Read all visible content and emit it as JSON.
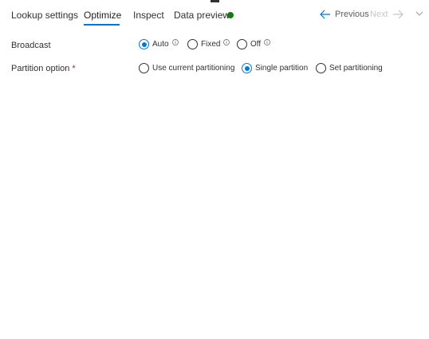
{
  "tabs": [
    {
      "label": "Lookup settings"
    },
    {
      "label": "Optimize"
    },
    {
      "label": "Inspect"
    },
    {
      "label": "Data preview"
    }
  ],
  "active_tab": "Optimize",
  "data_preview_status_color": "#107c10",
  "accent_color": "#0078d4",
  "nav": {
    "previous_label": "Previous",
    "next_label": "Next"
  },
  "broadcast": {
    "label": "Broadcast",
    "options": [
      {
        "label": "Auto",
        "checked": true
      },
      {
        "label": "Fixed",
        "checked": false
      },
      {
        "label": "Off",
        "checked": false
      }
    ]
  },
  "partition": {
    "label": "Partition option",
    "required_marker": "*",
    "options": [
      {
        "label": "Use current partitioning",
        "checked": false
      },
      {
        "label": "Single partition",
        "checked": true
      },
      {
        "label": "Set partitioning",
        "checked": false
      }
    ]
  }
}
